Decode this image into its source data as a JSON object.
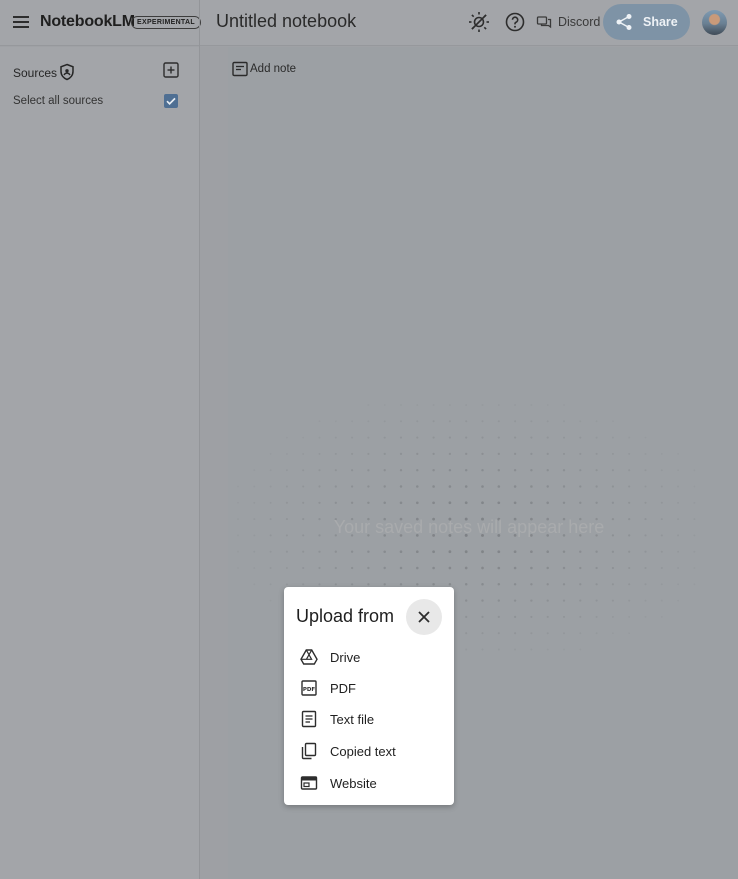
{
  "header": {
    "brand": "NotebookLM",
    "badge": "EXPERIMENTAL",
    "notebook_title": "Untitled notebook",
    "discord_label": "Discord",
    "share_label": "Share"
  },
  "sidebar": {
    "sources_label": "Sources",
    "select_all_label": "Select all sources",
    "select_all_checked": true
  },
  "main": {
    "add_note_label": "Add note",
    "empty_message": "Your saved notes will appear here"
  },
  "dialog": {
    "title": "Upload from",
    "options": [
      {
        "label": "Drive",
        "icon": "drive-icon"
      },
      {
        "label": "PDF",
        "icon": "pdf-icon"
      },
      {
        "label": "Text file",
        "icon": "text-file-icon"
      },
      {
        "label": "Copied text",
        "icon": "copied-text-icon"
      },
      {
        "label": "Website",
        "icon": "website-icon"
      }
    ]
  },
  "colors": {
    "overlay_bg": "#9fa1a5",
    "share_button": "#7e93a6",
    "checkbox": "#4f6f93",
    "dialog_bg": "#ffffff"
  }
}
